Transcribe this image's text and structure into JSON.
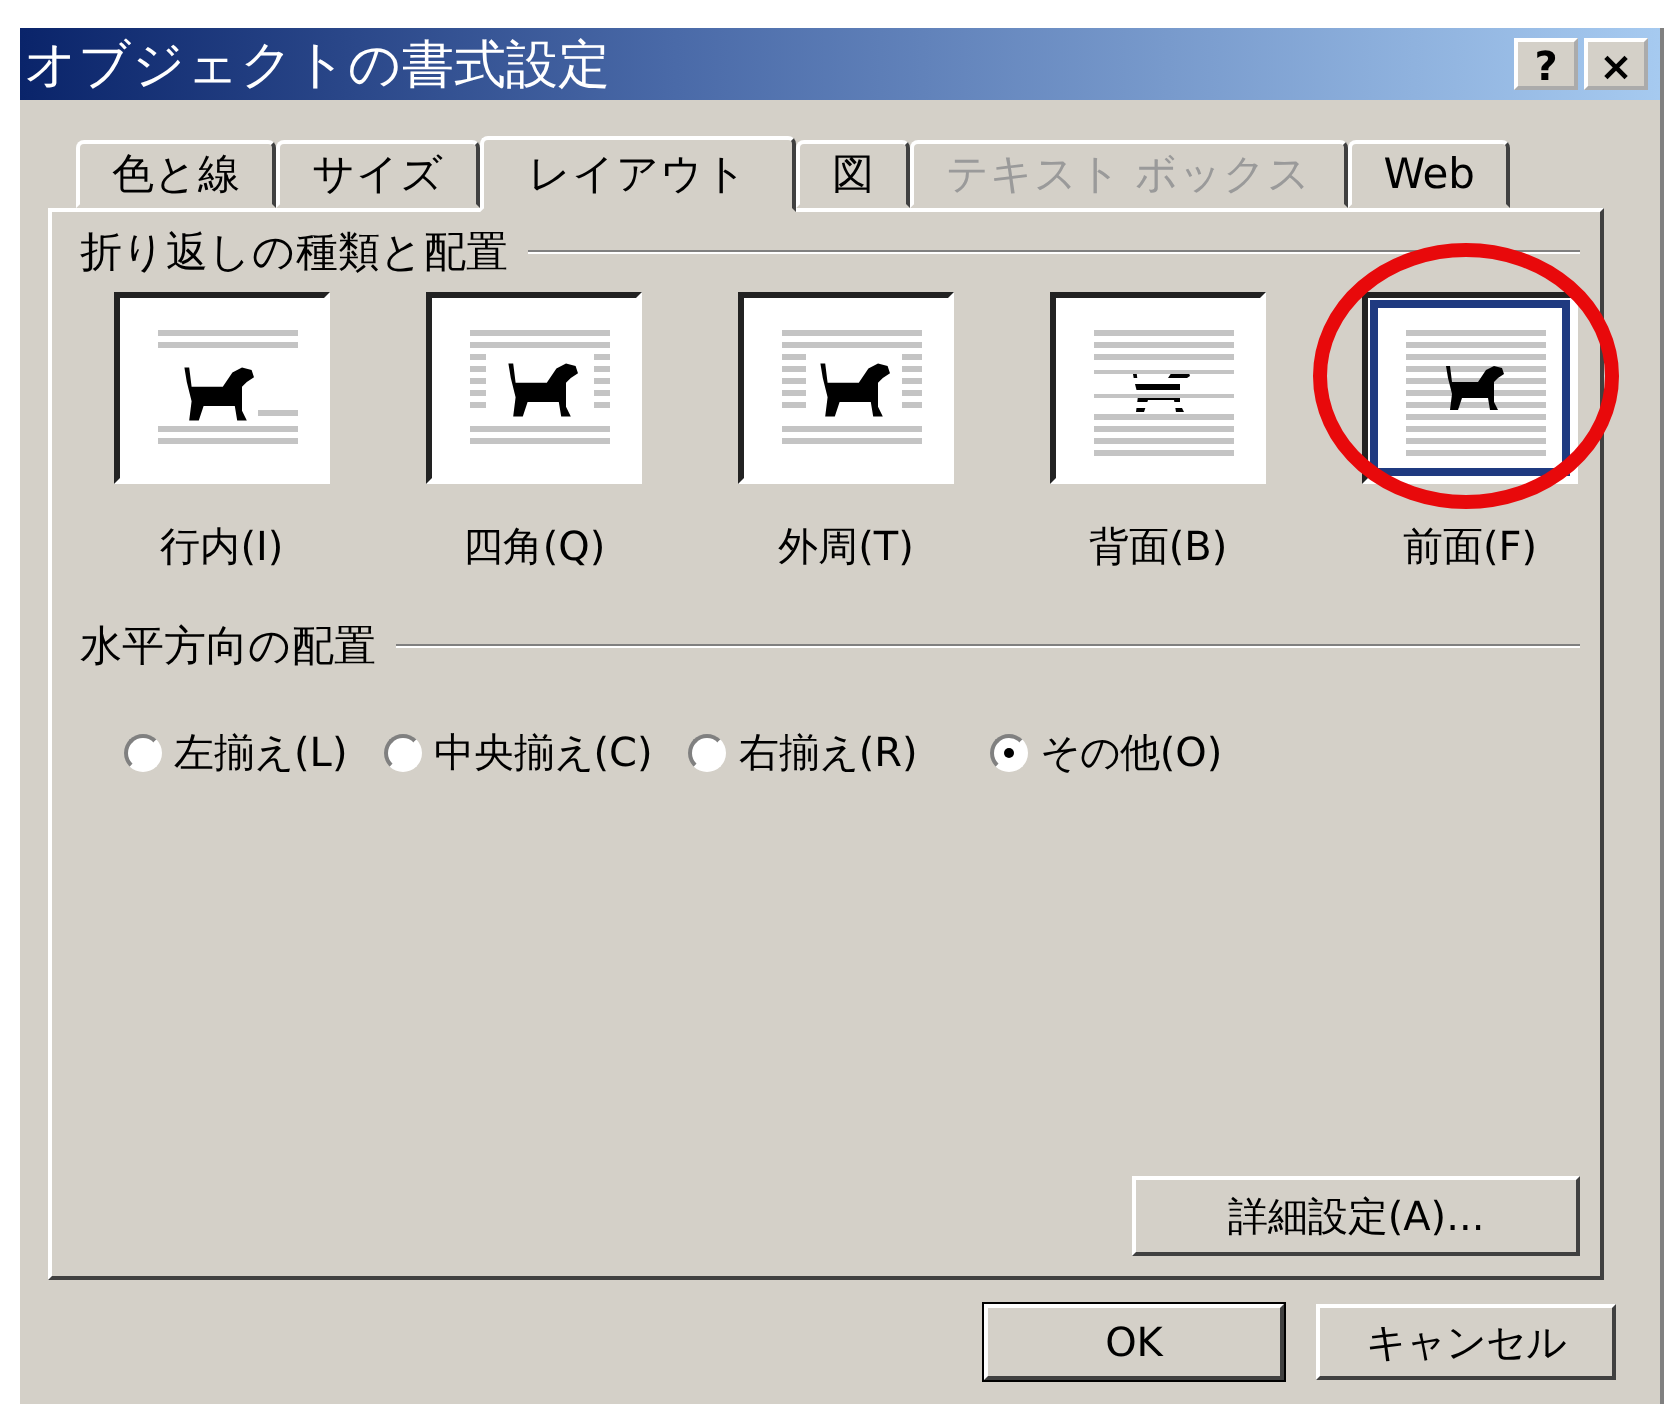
{
  "window": {
    "title": "オブジェクトの書式設定",
    "help_button": "?",
    "close_button": "×"
  },
  "tabs": [
    {
      "label": "色と線",
      "selected": false,
      "disabled": false
    },
    {
      "label": "サイズ",
      "selected": false,
      "disabled": false
    },
    {
      "label": "レイアウト",
      "selected": true,
      "disabled": false
    },
    {
      "label": "図",
      "selected": false,
      "disabled": false
    },
    {
      "label": "テキスト ボックス",
      "selected": false,
      "disabled": true
    },
    {
      "label": "Web",
      "selected": false,
      "disabled": false
    }
  ],
  "wrap_group": {
    "title": "折り返しの種類と配置",
    "options": [
      {
        "label": "行内(I)",
        "kind": "inline",
        "selected": false,
        "circled": false
      },
      {
        "label": "四角(Q)",
        "kind": "square",
        "selected": false,
        "circled": false
      },
      {
        "label": "外周(T)",
        "kind": "tight",
        "selected": false,
        "circled": false
      },
      {
        "label": "背面(B)",
        "kind": "behind",
        "selected": false,
        "circled": false
      },
      {
        "label": "前面(F)",
        "kind": "front",
        "selected": true,
        "circled": true
      }
    ]
  },
  "horizontal_group": {
    "title": "水平方向の配置",
    "options": [
      {
        "label": "左揃え(L)",
        "selected": false
      },
      {
        "label": "中央揃え(C)",
        "selected": false
      },
      {
        "label": "右揃え(R)",
        "selected": false
      },
      {
        "label": "その他(O)",
        "selected": true
      }
    ]
  },
  "advanced_button": "詳細設定(A)...",
  "buttons": [
    {
      "label": "OK",
      "default": true
    },
    {
      "label": "キャンセル",
      "default": false
    }
  ]
}
